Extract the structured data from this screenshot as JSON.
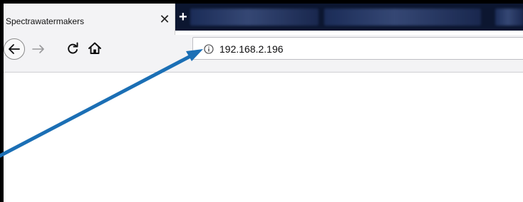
{
  "tab": {
    "title": "Spectrawatermakers",
    "close_label": "✕",
    "new_tab_label": "+"
  },
  "toolbar": {
    "back_icon": "back-arrow-icon",
    "forward_icon": "forward-arrow-icon",
    "reload_icon": "reload-icon",
    "home_icon": "home-icon"
  },
  "urlbar": {
    "value": "192.168.2.196",
    "info_icon": "info-icon"
  },
  "annotation": {
    "color": "#1b6fb5"
  }
}
